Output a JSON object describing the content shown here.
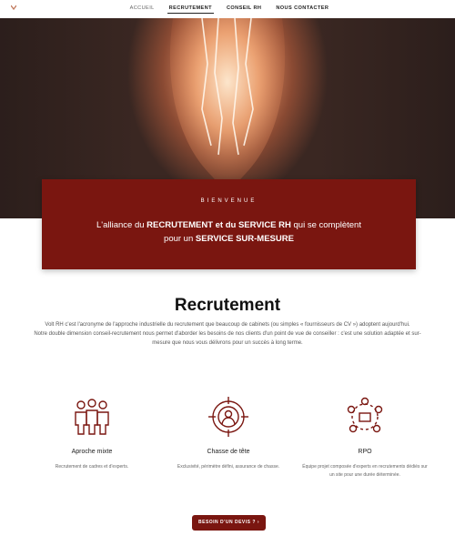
{
  "nav": {
    "items": [
      "Accueil",
      "Recrutement",
      "Conseil RH",
      "Nous contacter"
    ],
    "active": "Recrutement"
  },
  "banner": {
    "eyebrow": "BIENVENUE",
    "line1_a": "L'alliance du ",
    "line1_b": "RECRUTEMENT et du SERVICE RH",
    "line1_c": " qui se complètent",
    "line2_a": "pour un ",
    "line2_b": "SERVICE SUR-MESURE"
  },
  "section": {
    "title": "Recrutement",
    "para1": "Volt RH c'est l'acronyme de l'approche industrielle du recrutement que beaucoup de cabinets (ou simples « fournisseurs de CV ») adoptent aujourd'hui.",
    "para2": "Notre double dimension conseil-recrutement nous permet d'aborder les besoins de nos clients d'un point de vue de conseiller : c'est une solution adaptée et sur-mesure que nous vous délivrons pour un succès à long terme."
  },
  "features": [
    {
      "title": "Aproche mixte",
      "text": "Recrutement de cadres et d'experts.",
      "icon": "team-icon"
    },
    {
      "title": "Chasse de tête",
      "text": "Exclusivité, périmètre défini, assurance de chasse.",
      "icon": "target-person-icon"
    },
    {
      "title": "RPO",
      "text": "Équipe projet composée d'experts en recrutements dédiés sur un site pour une durée déterminée.",
      "icon": "network-icon"
    }
  ],
  "cta": {
    "label": "BESOIN D'UN DEVIS ?"
  },
  "colors": {
    "brand": "#7a1610",
    "text": "#333333"
  }
}
